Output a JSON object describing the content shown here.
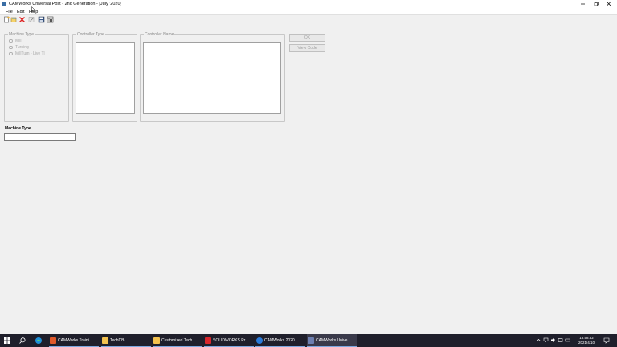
{
  "window": {
    "title": "CAMWorks Universal Post - 2nd Generation  - [July '2020]"
  },
  "menu": {
    "file": "File",
    "edit": "Edit",
    "help": "Help"
  },
  "toolbar": {
    "icons": [
      "new-icon",
      "open-icon",
      "delete-icon",
      "edit-icon",
      "save-icon",
      "view-icon"
    ]
  },
  "machine_type_group": {
    "title": "Machine Type",
    "options": [
      "Mill",
      "Turning",
      "MillTurn - Live Tl"
    ]
  },
  "controller_type_group": {
    "title": "Controller Type"
  },
  "controller_name_group": {
    "title": "Controller Name"
  },
  "buttons": {
    "ok": "OK",
    "view_code": "View Code"
  },
  "machine_type_field": {
    "label": "Machine Type",
    "value": ""
  },
  "taskbar": {
    "items": [
      {
        "label": "CAMWorks Traini...",
        "color": "#e0592a"
      },
      {
        "label": "TechDB",
        "color": "#f2c14e"
      },
      {
        "label": "Customized Tech...",
        "color": "#f2c14e"
      },
      {
        "label": "SOLIDWORKS Pr...",
        "color": "#d9262c"
      },
      {
        "label": "CAMWorks 2020 ...",
        "color": "#2a7ad9"
      },
      {
        "label": "CAMWorks Unive...",
        "color": "#6d7fb0"
      }
    ],
    "time": "18:58:52",
    "date": "2021/4/10"
  },
  "colors": {
    "taskbar_bg": "#1f1f2b",
    "window_bg": "#f0f0f0",
    "active_underline": "#7aa7e0"
  }
}
